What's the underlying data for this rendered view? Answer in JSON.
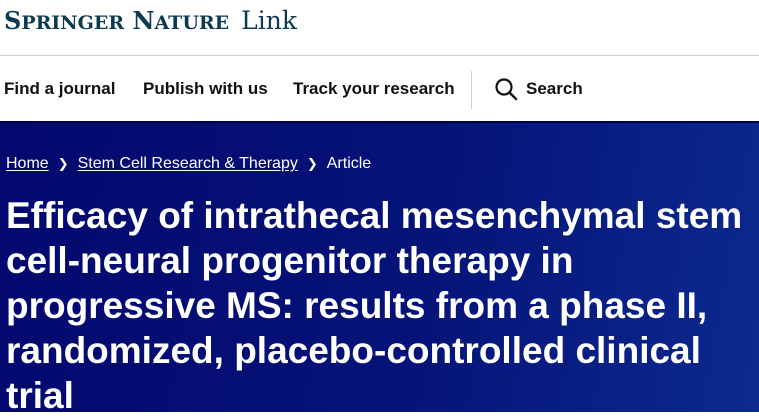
{
  "header": {
    "brand_big_s": "S",
    "brand_pringer": "PRINGER",
    "brand_big_n": "N",
    "brand_ature": "ATURE",
    "brand_link": "Link",
    "brand_color": "#0c3a52"
  },
  "nav": {
    "items": [
      {
        "label": "Find a journal"
      },
      {
        "label": "Publish with us"
      },
      {
        "label": "Track your research"
      }
    ],
    "search_label": "Search",
    "search_icon": "search-icon"
  },
  "hero": {
    "background_color": "#03086e",
    "breadcrumb": [
      {
        "label": "Home"
      },
      {
        "label": "Stem Cell Research & Therapy"
      },
      {
        "label": "Article"
      }
    ],
    "separator_icon": "chevron-right-icon",
    "title": "Efficacy of intrathecal mesenchymal stem cell-neural progenitor therapy in progressive MS: results from a phase II, randomized, placebo-controlled clinical trial"
  }
}
